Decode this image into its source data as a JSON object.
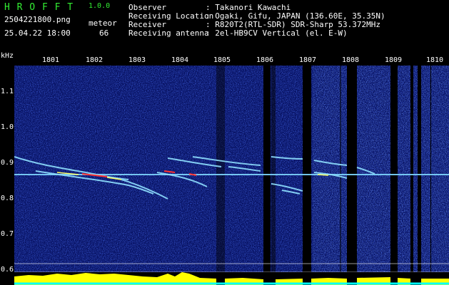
{
  "header": {
    "app_name": "H R O F F T",
    "version": "1.0.0",
    "filename": "2504221800.png",
    "datetime": "25.04.22 18:00",
    "meteor_label": "meteor",
    "meteor_count": "66",
    "info": [
      {
        "label": "Observer",
        "value": ": Takanori Kawachi"
      },
      {
        "label": "Receiving Location",
        "value": ": Ogaki, Gifu, JAPAN (136.60E, 35.35N)"
      },
      {
        "label": "Receiver",
        "value": ": R820T2(RTL-SDR) SDR-Sharp 53.372MHz"
      },
      {
        "label": "Receiving antenna",
        "value": ": 2el-HB9CV Vertical (el. E-W)"
      }
    ]
  },
  "axis": {
    "unit": "kHz",
    "y_ticks": [
      "1.1",
      "1.0",
      "0.9",
      "0.8",
      "0.7",
      "0.6"
    ],
    "x_ticks": [
      "1801",
      "1802",
      "1803",
      "1804",
      "1805",
      "1806",
      "1807",
      "1808",
      "1809",
      "1810"
    ]
  },
  "colors": {
    "background": "#000000",
    "noise": "#0a1a8c",
    "signal_line": "#7fd7ff",
    "hot": "#ff3030",
    "level_bar": "#ffff00",
    "baseline": "#00ffff",
    "header_green": "#33ee33"
  }
}
